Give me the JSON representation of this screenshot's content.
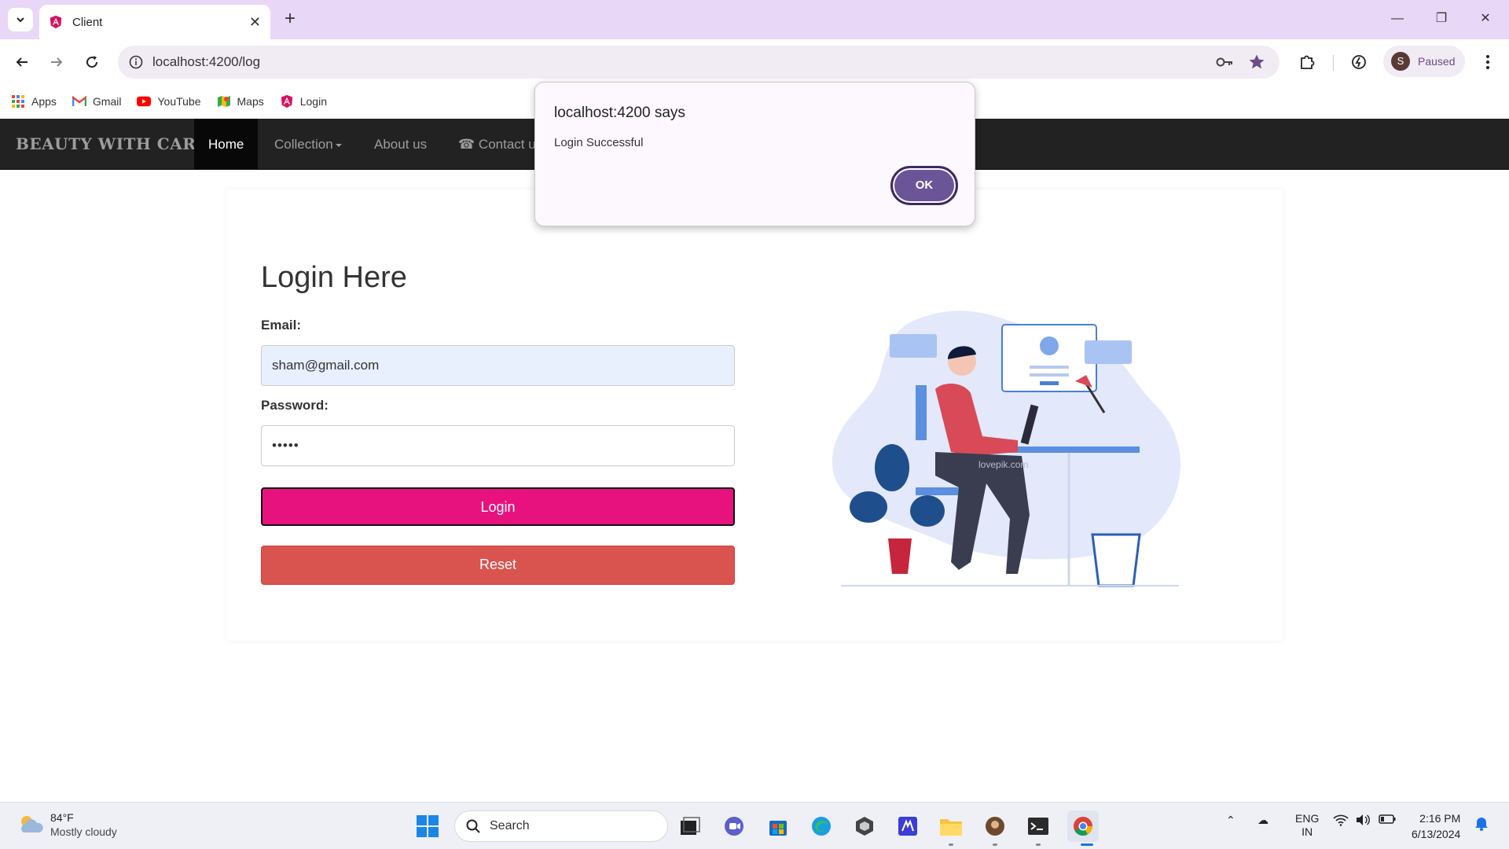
{
  "browser": {
    "tab_title": "Client",
    "url": "localhost:4200/log",
    "profile_initial": "S",
    "profile_status": "Paused",
    "bookmarks": [
      {
        "label": "Apps",
        "icon": "apps-grid-icon"
      },
      {
        "label": "Gmail",
        "icon": "gmail-icon"
      },
      {
        "label": "YouTube",
        "icon": "youtube-icon"
      },
      {
        "label": "Maps",
        "icon": "maps-icon"
      },
      {
        "label": "Login",
        "icon": "angular-icon"
      }
    ]
  },
  "navbar": {
    "brand": "BEAUTY WITH CARE",
    "items": [
      {
        "label": "Home",
        "active": true
      },
      {
        "label": "Collection",
        "dropdown": true
      },
      {
        "label": "About us"
      },
      {
        "label": "Contact u",
        "icon": "phone-icon"
      }
    ]
  },
  "login": {
    "title": "Login Here",
    "email_label": "Email:",
    "email_value": "sham@gmail.com",
    "password_label": "Password:",
    "password_value": "•••••",
    "login_button": "Login",
    "reset_button": "Reset",
    "watermark": "lovepik.com"
  },
  "dialog": {
    "title": "localhost:4200 says",
    "message": "Login Successful",
    "ok_label": "OK"
  },
  "taskbar": {
    "temperature": "84°F",
    "weather": "Mostly cloudy",
    "search_placeholder": "Search",
    "lang_top": "ENG",
    "lang_bottom": "IN",
    "time": "2:16 PM",
    "date": "6/13/2024"
  },
  "colors": {
    "login_button": "#e8127e",
    "reset_button": "#d9534f",
    "navbar": "#222222",
    "dialog_ok": "#6b5497",
    "tabbar": "#e9d7f7"
  }
}
